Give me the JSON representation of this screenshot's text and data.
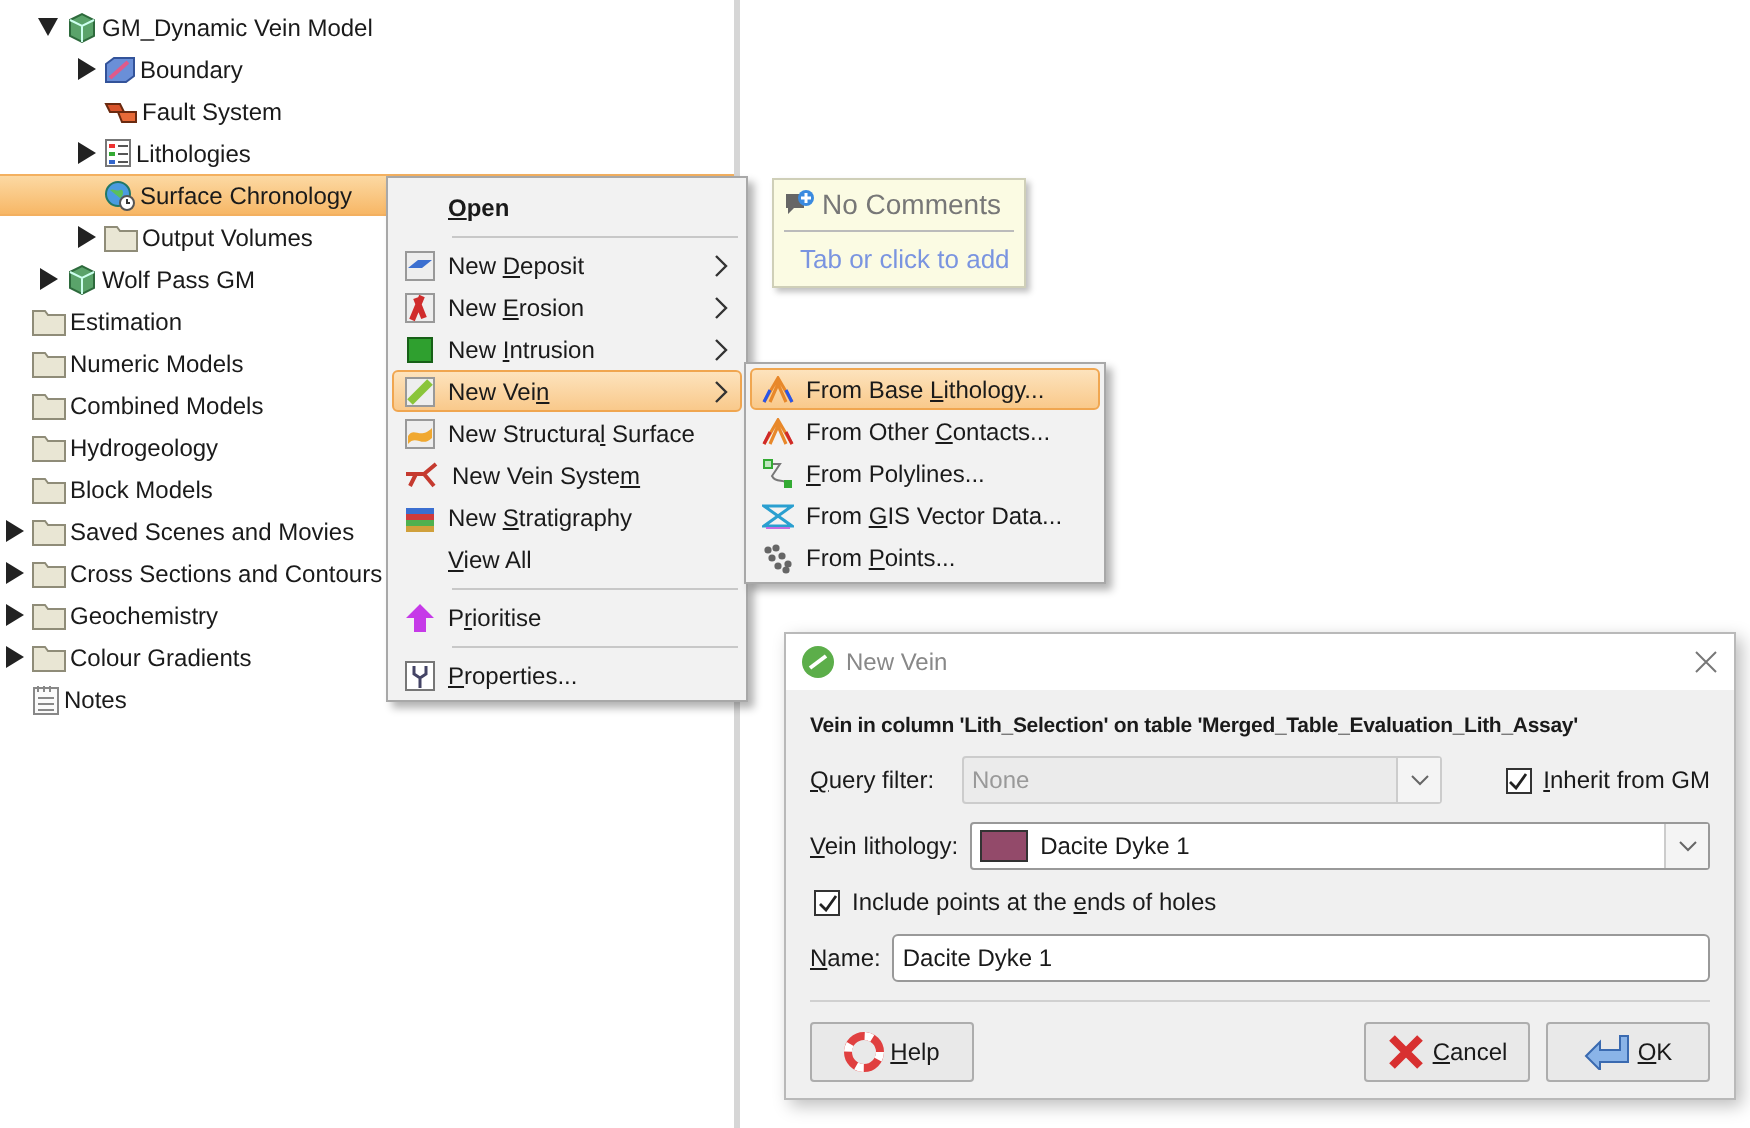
{
  "tree": {
    "items": [
      {
        "kind": "model",
        "label": "GM_Dynamic Vein Model",
        "expanded": true,
        "selected": false,
        "children": [
          {
            "kind": "boundary",
            "label": "Boundary",
            "expanded": false,
            "selected": false
          },
          {
            "kind": "faults",
            "label": "Fault System",
            "selected": false
          },
          {
            "kind": "lithologies",
            "label": "Lithologies",
            "expanded": false,
            "selected": false
          },
          {
            "kind": "chronology",
            "label": "Surface Chronology",
            "selected": true
          },
          {
            "kind": "folder",
            "label": "Output Volumes",
            "expanded": false,
            "selected": false
          }
        ]
      },
      {
        "kind": "model",
        "label": "Wolf Pass GM",
        "expanded": false,
        "selected": false
      },
      {
        "kind": "folder",
        "label": "Estimation",
        "selected": false
      },
      {
        "kind": "folder",
        "label": "Numeric Models",
        "selected": false
      },
      {
        "kind": "folder",
        "label": "Combined Models",
        "selected": false
      },
      {
        "kind": "folder",
        "label": "Hydrogeology",
        "selected": false
      },
      {
        "kind": "folder",
        "label": "Block Models",
        "selected": false
      },
      {
        "kind": "folder",
        "label": "Saved Scenes and Movies",
        "expanded": false,
        "selected": false
      },
      {
        "kind": "folder",
        "label": "Cross Sections and Contours",
        "expanded": false,
        "selected": false
      },
      {
        "kind": "folder",
        "label": "Geochemistry",
        "expanded": false,
        "selected": false
      },
      {
        "kind": "folder",
        "label": "Colour Gradients",
        "expanded": false,
        "selected": false
      },
      {
        "kind": "notes",
        "label": "Notes",
        "selected": false
      }
    ]
  },
  "context_menu": {
    "items": [
      {
        "kind": "default",
        "label": {
          "key": "O",
          "post": "pen"
        },
        "submenu": false,
        "selected": false
      },
      {
        "kind": "separator"
      },
      {
        "kind": "command",
        "label": {
          "pre": "New ",
          "key": "D",
          "post": "eposit"
        },
        "submenu": true,
        "selected": false
      },
      {
        "kind": "command",
        "label": {
          "pre": "New ",
          "key": "E",
          "post": "rosion"
        },
        "submenu": true,
        "selected": false
      },
      {
        "kind": "command",
        "label": {
          "pre": "New ",
          "key": "I",
          "post": "ntrusion"
        },
        "submenu": true,
        "selected": false
      },
      {
        "kind": "command",
        "label": {
          "pre": "New Vei",
          "key": "n"
        },
        "submenu": true,
        "selected": true
      },
      {
        "kind": "command",
        "label": {
          "pre": "New Structura",
          "key": "l",
          "post": " Surface"
        },
        "submenu": false,
        "selected": false
      },
      {
        "kind": "command",
        "label": {
          "pre": "New Vein Syste",
          "key": "m"
        },
        "submenu": false,
        "selected": false
      },
      {
        "kind": "command",
        "label": {
          "pre": "New ",
          "key": "S",
          "post": "tratigraphy"
        },
        "submenu": false,
        "selected": false
      },
      {
        "kind": "command",
        "label": {
          "key": "V",
          "post": "iew All"
        },
        "submenu": false,
        "selected": false
      },
      {
        "kind": "separator"
      },
      {
        "kind": "command",
        "label": {
          "pre": "P",
          "key": "r",
          "post": "ioritise"
        },
        "submenu": false,
        "selected": false
      },
      {
        "kind": "separator"
      },
      {
        "kind": "command",
        "label": {
          "key": "P",
          "post": "roperties..."
        },
        "submenu": false,
        "selected": false
      }
    ]
  },
  "submenu": {
    "items": [
      {
        "label": {
          "pre": "From Base ",
          "key": "L",
          "post": "ithology..."
        },
        "selected": true
      },
      {
        "label": {
          "pre": "From Other ",
          "key": "C",
          "post": "ontacts..."
        },
        "selected": false
      },
      {
        "label": {
          "key": "F",
          "post": "rom Polylines..."
        },
        "selected": false
      },
      {
        "label": {
          "pre": "From ",
          "key": "G",
          "post": "IS Vector Data..."
        },
        "selected": false
      },
      {
        "label": {
          "pre": "From ",
          "key": "P",
          "post": "oints..."
        },
        "selected": false
      }
    ]
  },
  "comment_box": {
    "title": "No Comments",
    "hint": "Tab or click to add"
  },
  "dialog": {
    "title": "New Vein",
    "description": "Vein in column 'Lith_Selection' on table 'Merged_Table_Evaluation_Lith_Assay'",
    "query_filter": {
      "label": {
        "key": "Q",
        "post": "uery filter:"
      },
      "value": "None",
      "disabled": true
    },
    "inherit": {
      "label": {
        "key": "I",
        "post": "nherit from GM"
      },
      "checked": true
    },
    "vein_lithology": {
      "label": {
        "key": "V",
        "post": "ein lithology:"
      },
      "value": "Dacite Dyke 1",
      "color": "#934a6a"
    },
    "include_ends": {
      "label": {
        "pre": "Include points at the ",
        "key": "e",
        "post": "nds of holes"
      },
      "checked": true
    },
    "name": {
      "label": {
        "key": "N",
        "post": "ame:"
      },
      "value": "Dacite Dyke 1"
    },
    "buttons": [
      {
        "kind": "help",
        "label": {
          "key": "H",
          "post": "elp"
        }
      },
      {
        "kind": "cancel",
        "label": {
          "key": "C",
          "post": "ancel"
        }
      },
      {
        "kind": "ok",
        "label": {
          "key": "O",
          "post": "K"
        }
      }
    ]
  }
}
